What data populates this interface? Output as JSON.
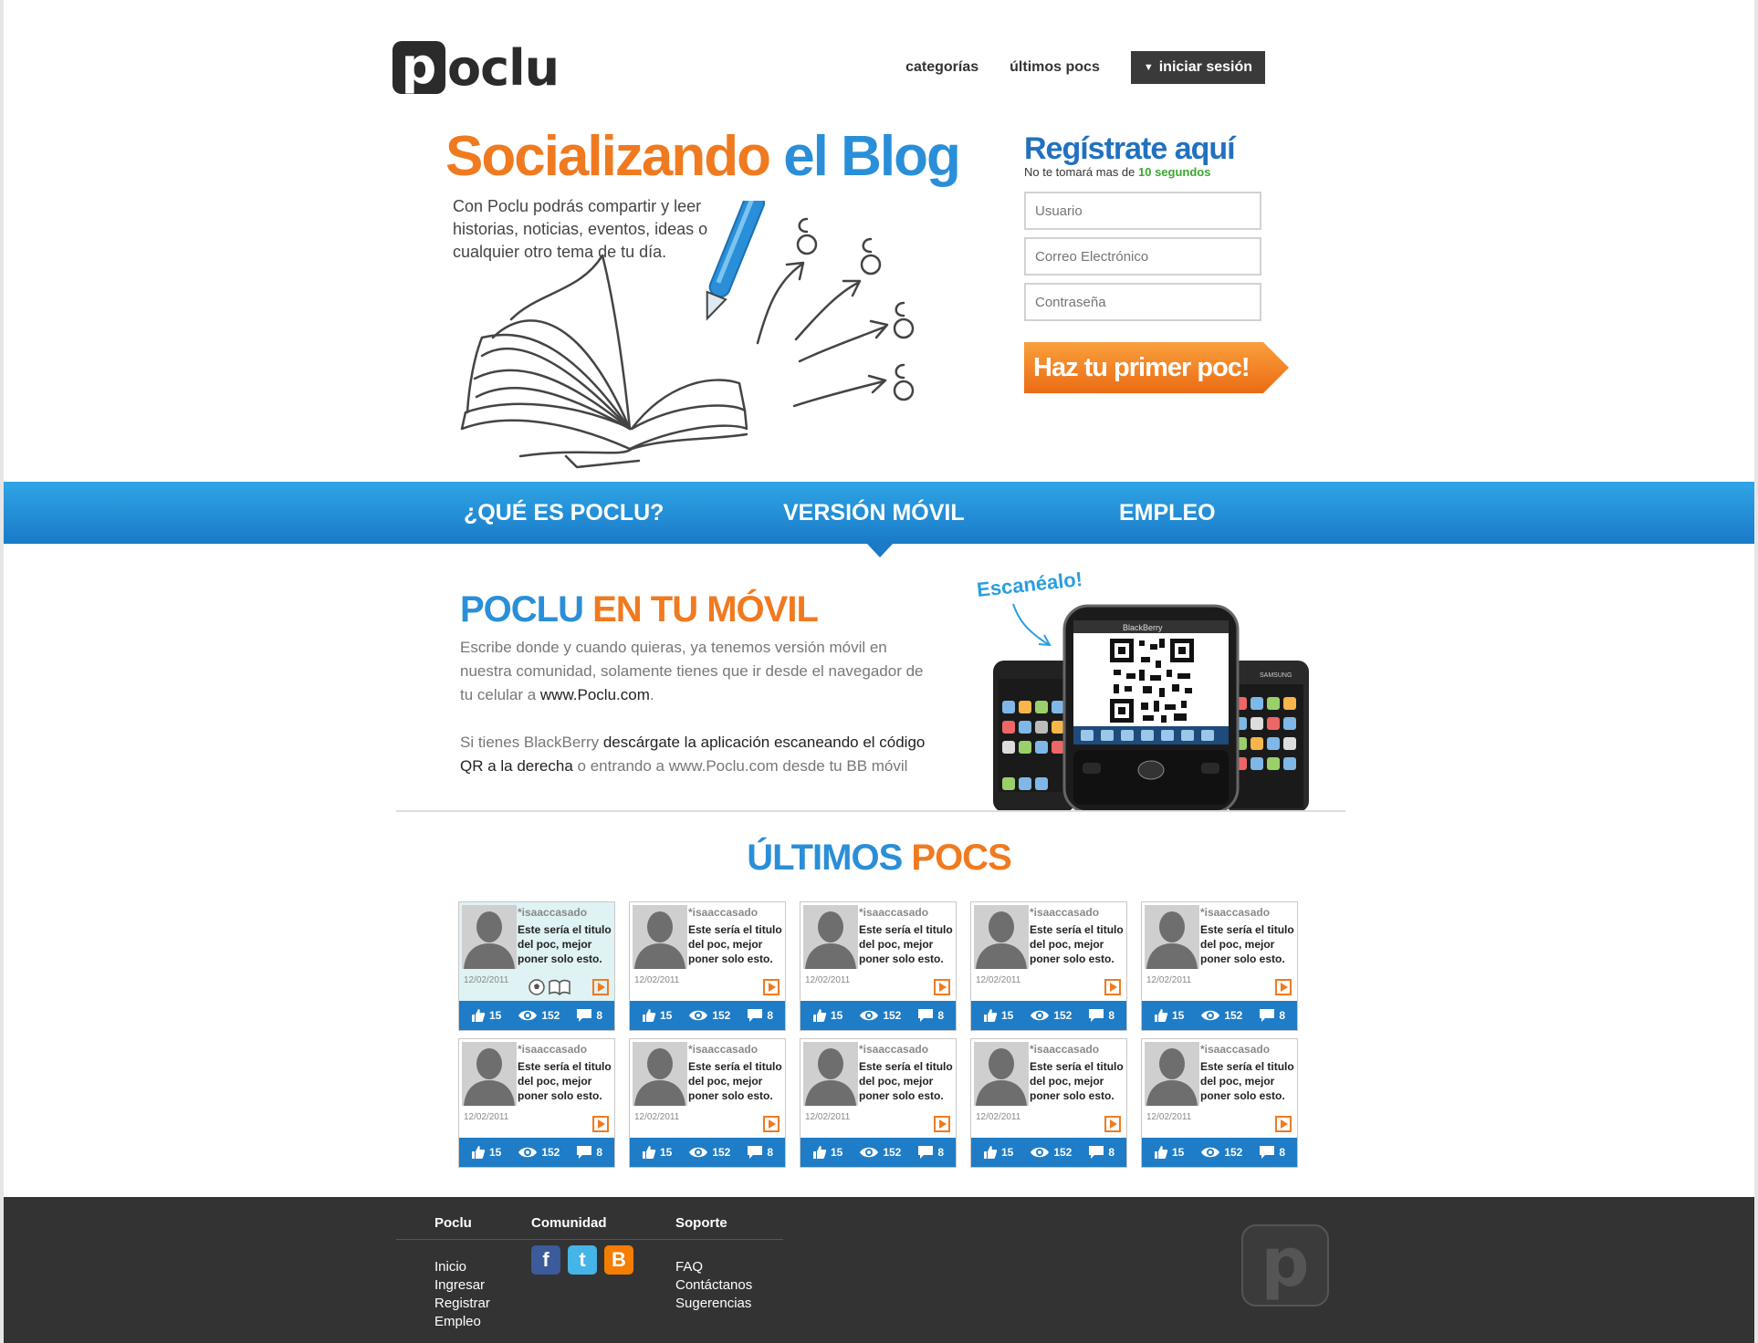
{
  "header": {
    "logo_letter": "p",
    "logo_text": "oclu",
    "nav": [
      "categorías",
      "últimos pocs"
    ],
    "login_label": "iniciar sesión"
  },
  "hero": {
    "title_part1": "Socializando",
    "title_part2": "el Blog",
    "description": "Con Poclu podrás compartir y leer historias, noticias, eventos, ideas o cualquier otro tema de tu día."
  },
  "register": {
    "title": "Regístrate aquí",
    "subtitle_prefix": "No te tomará mas de ",
    "subtitle_highlight": "10 segundos",
    "username_placeholder": "Usuario",
    "email_placeholder": "Correo Electrónico",
    "password_placeholder": "Contraseña",
    "cta_label": "Haz tu primer poc!"
  },
  "tabs": [
    {
      "label": "¿QUÉ ES POCLU?"
    },
    {
      "label": "VERSIÓN MÓVIL",
      "active": true
    },
    {
      "label": "EMPLEO"
    }
  ],
  "mobile": {
    "title_part1": "POCLU",
    "title_part2": "EN TU MÓVIL",
    "p1_text": "Escribe donde y cuando quieras, ya tenemos versión móvil en nuestra comunidad, solamente tienes que ir desde el navegador de tu celular a ",
    "p1_link": "www.Poclu.com",
    "p1_end": ".",
    "p2_a": "Si tienes BlackBerry ",
    "p2_b": "descárgate la aplicación escaneando el código QR a la derecha",
    "p2_c": " o entrando a www.Poclu.com desde tu BB móvil",
    "scan_label": "Escanéalo!",
    "phone_brand": "BlackBerry",
    "phone_brand_2": "SAMSUNG"
  },
  "latest": {
    "title_part1": "ÚLTIMOS",
    "title_part2": "POCS",
    "cards": [
      {
        "user": "*isaaccasado",
        "title": "Este sería el titulo del poc, mejor poner solo esto.",
        "date": "12/02/2011",
        "likes": "15",
        "views": "152",
        "comments": "8",
        "active": true
      },
      {
        "user": "*isaaccasado",
        "title": "Este sería el titulo del poc, mejor poner solo esto.",
        "date": "12/02/2011",
        "likes": "15",
        "views": "152",
        "comments": "8"
      },
      {
        "user": "*isaaccasado",
        "title": "Este sería el titulo del poc, mejor poner solo esto.",
        "date": "12/02/2011",
        "likes": "15",
        "views": "152",
        "comments": "8"
      },
      {
        "user": "*isaaccasado",
        "title": "Este sería el titulo del poc, mejor poner solo esto.",
        "date": "12/02/2011",
        "likes": "15",
        "views": "152",
        "comments": "8"
      },
      {
        "user": "*isaaccasado",
        "title": "Este sería el titulo del poc, mejor poner solo esto.",
        "date": "12/02/2011",
        "likes": "15",
        "views": "152",
        "comments": "8"
      },
      {
        "user": "*isaaccasado",
        "title": "Este sería el titulo del poc, mejor poner solo esto.",
        "date": "12/02/2011",
        "likes": "15",
        "views": "152",
        "comments": "8"
      },
      {
        "user": "*isaaccasado",
        "title": "Este sería el titulo del poc, mejor poner solo esto.",
        "date": "12/02/2011",
        "likes": "15",
        "views": "152",
        "comments": "8"
      },
      {
        "user": "*isaaccasado",
        "title": "Este sería el titulo del poc, mejor poner solo esto.",
        "date": "12/02/2011",
        "likes": "15",
        "views": "152",
        "comments": "8"
      },
      {
        "user": "*isaaccasado",
        "title": "Este sería el titulo del poc, mejor poner solo esto.",
        "date": "12/02/2011",
        "likes": "15",
        "views": "152",
        "comments": "8"
      },
      {
        "user": "*isaaccasado",
        "title": "Este sería el titulo del poc, mejor poner solo esto.",
        "date": "12/02/2011",
        "likes": "15",
        "views": "152",
        "comments": "8"
      }
    ]
  },
  "footer": {
    "col1_title": "Poclu",
    "col1_links": [
      "Inicio",
      "Ingresar",
      "Registrar",
      "Empleo"
    ],
    "col2_title": "Comunidad",
    "social": [
      "facebook-icon",
      "twitter-icon",
      "blogger-icon"
    ],
    "col3_title": "Soporte",
    "col3_links": [
      "FAQ",
      "Contáctanos",
      "Sugerencias"
    ],
    "logo_letter": "p"
  },
  "colors": {
    "orange": "#f07a20",
    "blue": "#2a8fd8",
    "dark_blue": "#1f7cc6",
    "footer": "#333333"
  }
}
